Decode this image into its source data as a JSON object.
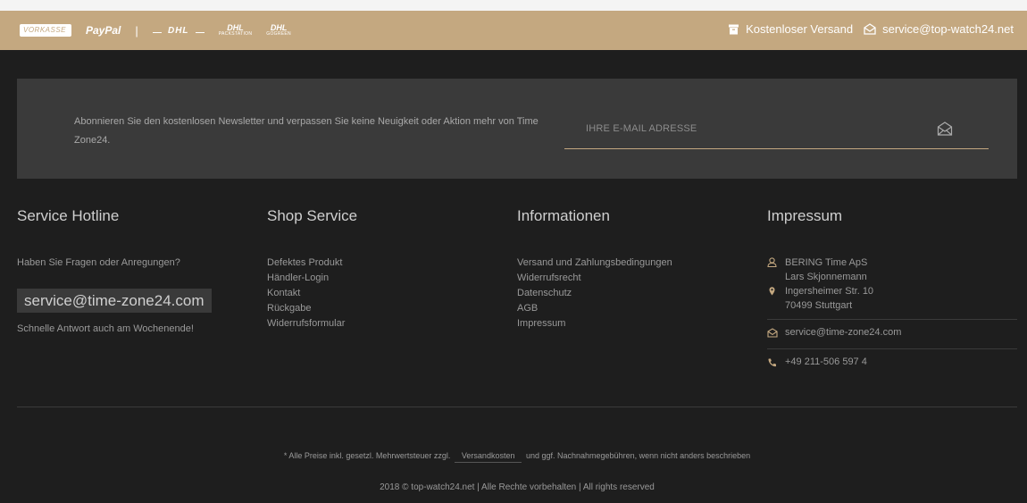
{
  "paybar": {
    "logos": {
      "vorkasse": "VORKASSE",
      "paypal": "PayPal",
      "separator": "|",
      "dhl": "DHL",
      "dhl_packstation_big": "DHL",
      "dhl_packstation_small": "PACKSTATION",
      "dhl_gogreen_big": "DHL",
      "dhl_gogreen_small": "GOGREEN"
    },
    "shipping_label": "Kostenloser Versand",
    "email": "service@top-watch24.net",
    "color": "#c4a880"
  },
  "newsletter": {
    "text": "Abonnieren Sie den kostenlosen Newsletter und verpassen Sie keine Neuigkeit oder Aktion mehr von Time Zone24.",
    "placeholder": "IHRE E-MAIL ADRESSE"
  },
  "columns": {
    "hotline": {
      "title": "Service Hotline",
      "question": "Haben Sie Fragen oder Anregungen?",
      "email": "service@time-zone24.com",
      "subtext": "Schnelle Antwort auch am Wochenende!"
    },
    "shop_service": {
      "title": "Shop Service",
      "links": [
        "Defektes Produkt",
        "Händler-Login",
        "Kontakt",
        "Rückgabe",
        "Widerrufsformular"
      ]
    },
    "informationen": {
      "title": "Informationen",
      "links": [
        "Versand und Zahlungsbedingungen",
        "Widerrufsrecht",
        "Datenschutz",
        "AGB",
        "Impressum"
      ]
    },
    "impressum": {
      "title": "Impressum",
      "company": "BERING Time ApS",
      "person": "Lars Skjonnemann",
      "street": "Ingersheimer Str. 10",
      "city": "70499 Stuttgart",
      "email": "service@time-zone24.com",
      "phone": "+49 211-506 597 4"
    }
  },
  "footer": {
    "vat_before": "* Alle Preise inkl. gesetzl. Mehrwertsteuer zzgl.",
    "vat_link": "Versandkosten",
    "vat_after": "und ggf. Nachnahmegebühren, wenn nicht anders beschrieben",
    "copyright": "2018 © top-watch24.net | Alle Rechte vorbehalten | All rights reserved"
  },
  "icons": {
    "shipping": "box-icon",
    "mail": "envelope-open-icon",
    "user": "user-icon",
    "location": "map-pin-icon",
    "phone": "phone-icon"
  }
}
